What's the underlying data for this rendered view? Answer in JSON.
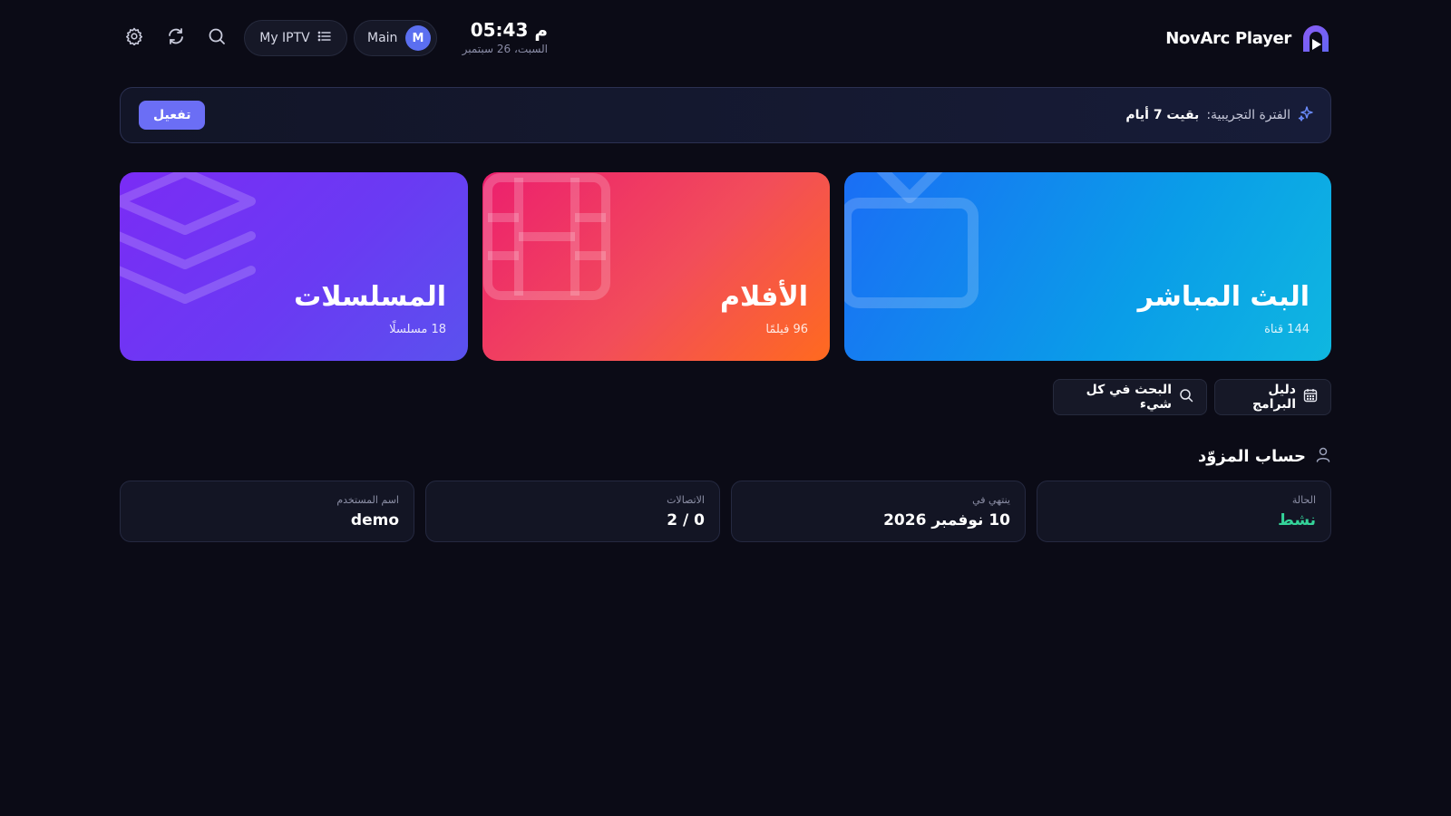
{
  "app": {
    "name": "NovArc Player"
  },
  "header": {
    "time": "05:43 م",
    "date": "السبت، 26 سبتمبر",
    "profile": {
      "name": "Main",
      "initial": "M"
    },
    "playlist": {
      "name": "My IPTV"
    },
    "icons": [
      "search-icon",
      "refresh-icon",
      "gear-icon"
    ]
  },
  "trial": {
    "label": "الفترة التجريبية:",
    "remaining": "بقيت 7 أيام",
    "button": "تفعيل"
  },
  "categories": [
    {
      "title": "البث المباشر",
      "count": "144 قناة"
    },
    {
      "title": "الأفلام",
      "count": "96 فيلمًا"
    },
    {
      "title": "المسلسلات",
      "count": "18 مسلسلًا"
    }
  ],
  "quick_actions": {
    "guide": "دليل البرامج",
    "search": "البحث في كل شيء"
  },
  "account": {
    "title": "حساب المزوّد",
    "fields": [
      {
        "label": "الحالة",
        "value": "نشط"
      },
      {
        "label": "ينتهي في",
        "value": "10 نوفمبر 2026"
      },
      {
        "label": "الاتصالات",
        "value": "0 / 2"
      },
      {
        "label": "اسم المستخدم",
        "value": "demo"
      }
    ]
  },
  "colors": {
    "background": "#0b0b16",
    "accent": "#6b6ef5",
    "status_active": "#34d399",
    "live_card": "#1a6ef5",
    "movies_card": "#ec1f6e",
    "series_card": "#7a2cf5"
  }
}
